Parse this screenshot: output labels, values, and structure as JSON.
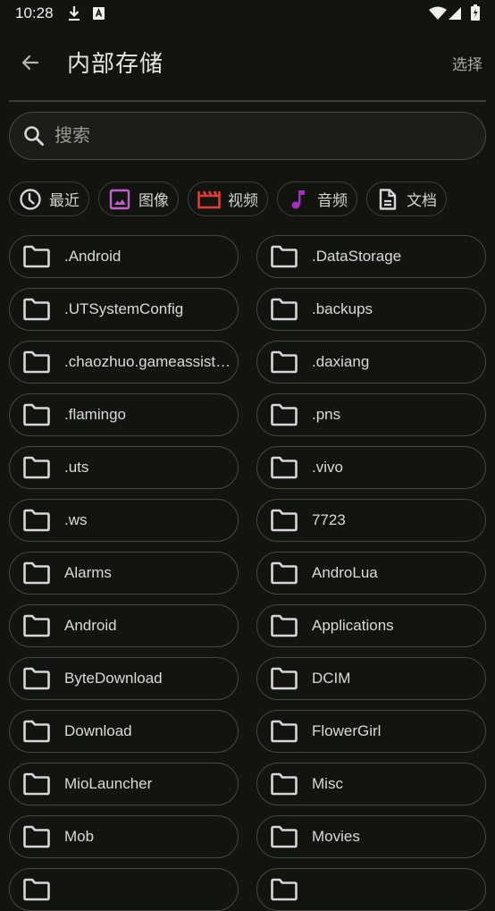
{
  "status_bar": {
    "time": "10:28",
    "left_icons": [
      "download-icon",
      "keyboard-a-icon"
    ],
    "right_icons": [
      "wifi-icon",
      "signal-icon",
      "battery-charging-icon"
    ]
  },
  "app_bar": {
    "back_icon": "arrow-left-icon",
    "title": "内部存储",
    "action_label": "选择"
  },
  "search": {
    "icon": "search-icon",
    "placeholder": "搜索",
    "value": ""
  },
  "categories": [
    {
      "label": "最近",
      "icon": "clock-icon",
      "color": "#d8d4da"
    },
    {
      "label": "图像",
      "icon": "image-icon",
      "color": "#c85fd1"
    },
    {
      "label": "视频",
      "icon": "clapperboard-icon",
      "color": "#e23a3a"
    },
    {
      "label": "音频",
      "icon": "music-note-icon",
      "color": "#a22fc0"
    },
    {
      "label": "文档",
      "icon": "document-icon",
      "color": "#d8d4da"
    }
  ],
  "folders": [
    {
      "name": ".Android"
    },
    {
      "name": ".DataStorage"
    },
    {
      "name": ".UTSystemConfig"
    },
    {
      "name": ".backups"
    },
    {
      "name": ".chaozhuo.gameassist…"
    },
    {
      "name": ".daxiang"
    },
    {
      "name": ".flamingo"
    },
    {
      "name": ".pns"
    },
    {
      "name": ".uts"
    },
    {
      "name": ".vivo"
    },
    {
      "name": ".ws"
    },
    {
      "name": "7723"
    },
    {
      "name": "Alarms"
    },
    {
      "name": "AndroLua"
    },
    {
      "name": "Android"
    },
    {
      "name": "Applications"
    },
    {
      "name": "ByteDownload"
    },
    {
      "name": "DCIM"
    },
    {
      "name": "Download"
    },
    {
      "name": "FlowerGirl"
    },
    {
      "name": "MioLauncher"
    },
    {
      "name": "Misc"
    },
    {
      "name": "Mob"
    },
    {
      "name": "Movies"
    },
    {
      "name": ""
    },
    {
      "name": ""
    }
  ],
  "colors": {
    "background": "#12140f",
    "outline": "#454740",
    "icon_default": "#d8d4da"
  }
}
